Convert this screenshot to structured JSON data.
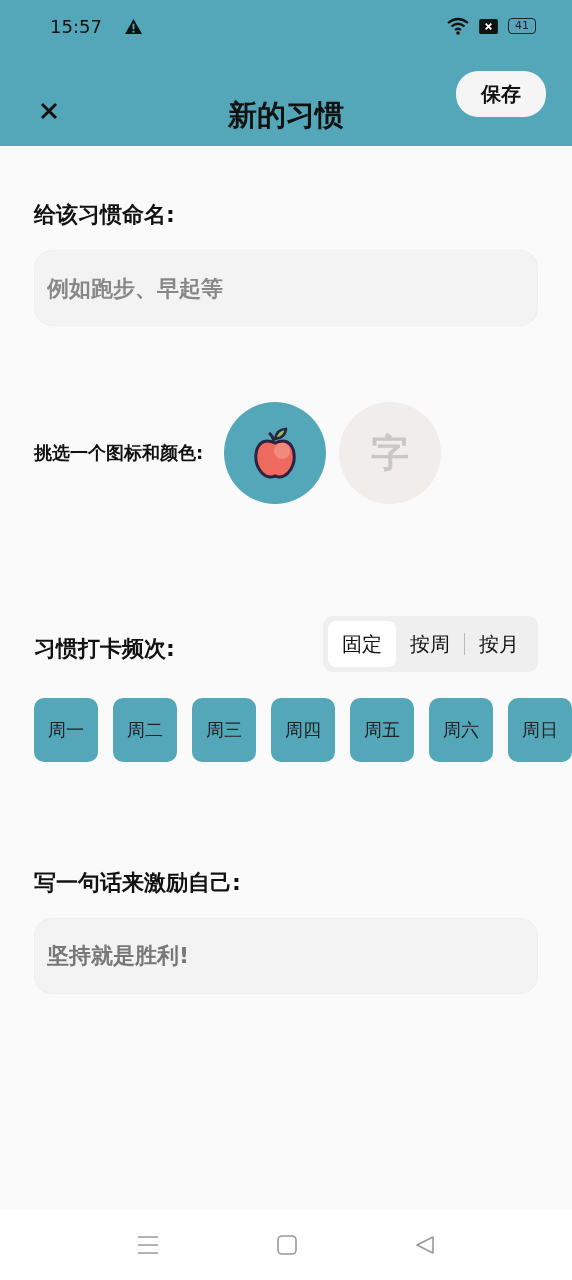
{
  "status_bar": {
    "time": "15:57",
    "battery": "41"
  },
  "header": {
    "title": "新的习惯",
    "save": "保存"
  },
  "name_section": {
    "label": "给该习惯命名:",
    "placeholder": "例如跑步、早起等"
  },
  "icon_section": {
    "label": "挑选一个图标和颜色:",
    "options": [
      {
        "kind": "icon",
        "selected": true
      },
      {
        "kind": "text",
        "text": "字",
        "selected": false
      }
    ]
  },
  "frequency_section": {
    "label": "习惯打卡频次:",
    "modes": [
      {
        "label": "固定",
        "selected": true
      },
      {
        "label": "按周",
        "selected": false
      },
      {
        "label": "按月",
        "selected": false
      }
    ],
    "days": [
      {
        "label": "周一",
        "selected": true
      },
      {
        "label": "周二",
        "selected": true
      },
      {
        "label": "周三",
        "selected": true
      },
      {
        "label": "周四",
        "selected": true
      },
      {
        "label": "周五",
        "selected": true
      },
      {
        "label": "周六",
        "selected": true
      },
      {
        "label": "周日",
        "selected": true
      }
    ]
  },
  "motto_section": {
    "label": "写一句话来激励自己:",
    "value": "坚持就是胜利!"
  }
}
